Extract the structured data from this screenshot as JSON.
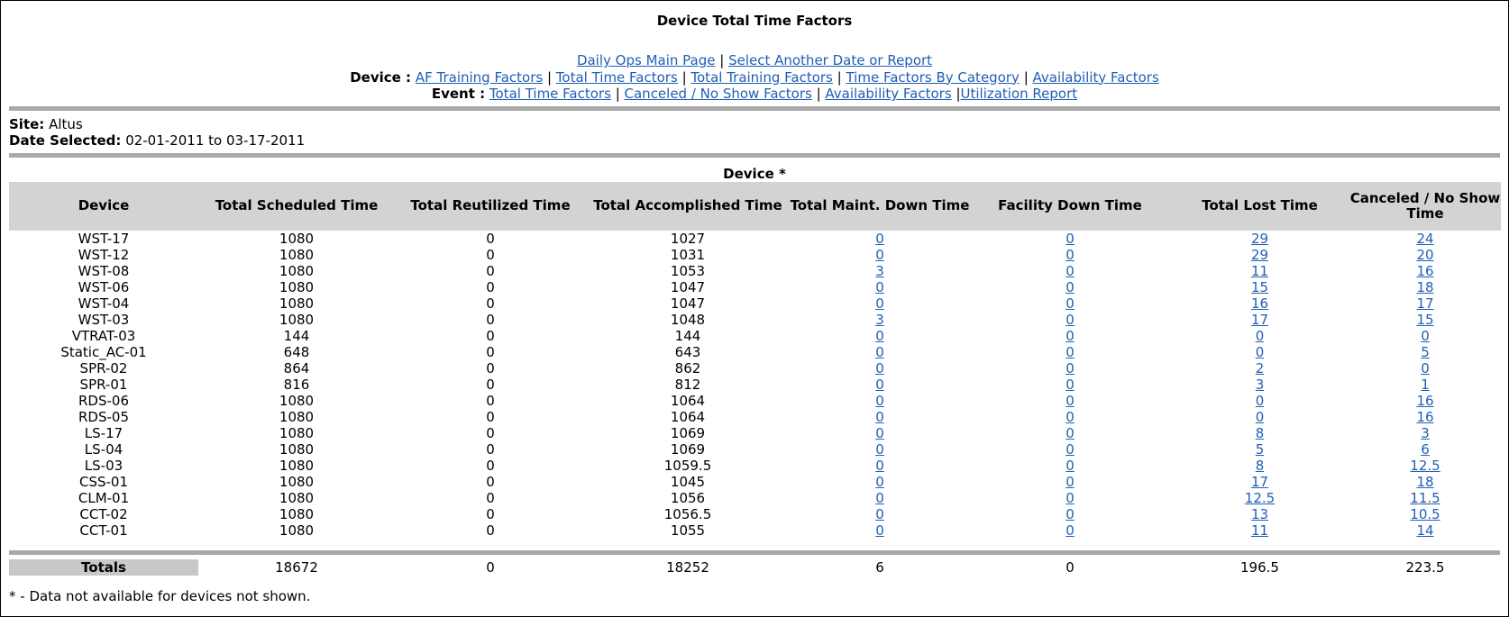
{
  "page": {
    "title": "Device Total Time Factors",
    "nav_top": [
      "Daily Ops Main Page",
      "Select Another Date or Report"
    ],
    "device_label": "Device :",
    "device_links": [
      "AF Training Factors",
      "Total Time Factors",
      "Total Training Factors",
      "Time Factors By Category",
      "Availability Factors"
    ],
    "event_label": "Event :",
    "event_links": [
      "Total Time Factors",
      "Canceled / No Show Factors",
      "Availability Factors",
      "Utilization Report"
    ]
  },
  "info": {
    "site_label": "Site:",
    "site_value": "Altus",
    "date_label": "Date Selected:",
    "date_value": "02-01-2011 to 03-17-2011"
  },
  "table": {
    "section_title": "Device *",
    "headers": [
      "Device",
      "Total Scheduled Time",
      "Total Reutilized Time",
      "Total Accomplished Time",
      "Total Maint. Down Time",
      "Facility Down Time",
      "Total Lost Time",
      "Canceled / No Show Time"
    ],
    "rows": [
      [
        "WST-17",
        "1080",
        "0",
        "1027",
        "0",
        "0",
        "29",
        "24"
      ],
      [
        "WST-12",
        "1080",
        "0",
        "1031",
        "0",
        "0",
        "29",
        "20"
      ],
      [
        "WST-08",
        "1080",
        "0",
        "1053",
        "3",
        "0",
        "11",
        "16"
      ],
      [
        "WST-06",
        "1080",
        "0",
        "1047",
        "0",
        "0",
        "15",
        "18"
      ],
      [
        "WST-04",
        "1080",
        "0",
        "1047",
        "0",
        "0",
        "16",
        "17"
      ],
      [
        "WST-03",
        "1080",
        "0",
        "1048",
        "3",
        "0",
        "17",
        "15"
      ],
      [
        "VTRAT-03",
        "144",
        "0",
        "144",
        "0",
        "0",
        "0",
        "0"
      ],
      [
        "Static_AC-01",
        "648",
        "0",
        "643",
        "0",
        "0",
        "0",
        "5"
      ],
      [
        "SPR-02",
        "864",
        "0",
        "862",
        "0",
        "0",
        "2",
        "0"
      ],
      [
        "SPR-01",
        "816",
        "0",
        "812",
        "0",
        "0",
        "3",
        "1"
      ],
      [
        "RDS-06",
        "1080",
        "0",
        "1064",
        "0",
        "0",
        "0",
        "16"
      ],
      [
        "RDS-05",
        "1080",
        "0",
        "1064",
        "0",
        "0",
        "0",
        "16"
      ],
      [
        "LS-17",
        "1080",
        "0",
        "1069",
        "0",
        "0",
        "8",
        "3"
      ],
      [
        "LS-04",
        "1080",
        "0",
        "1069",
        "0",
        "0",
        "5",
        "6"
      ],
      [
        "LS-03",
        "1080",
        "0",
        "1059.5",
        "0",
        "0",
        "8",
        "12.5"
      ],
      [
        "CSS-01",
        "1080",
        "0",
        "1045",
        "0",
        "0",
        "17",
        "18"
      ],
      [
        "CLM-01",
        "1080",
        "0",
        "1056",
        "0",
        "0",
        "12.5",
        "11.5"
      ],
      [
        "CCT-02",
        "1080",
        "0",
        "1056.5",
        "0",
        "0",
        "13",
        "10.5"
      ],
      [
        "CCT-01",
        "1080",
        "0",
        "1055",
        "0",
        "0",
        "11",
        "14"
      ]
    ],
    "totals_label": "Totals",
    "totals": [
      "18672",
      "0",
      "18252",
      "6",
      "0",
      "196.5",
      "223.5"
    ]
  },
  "footnote": "* - Data not available for devices not shown."
}
